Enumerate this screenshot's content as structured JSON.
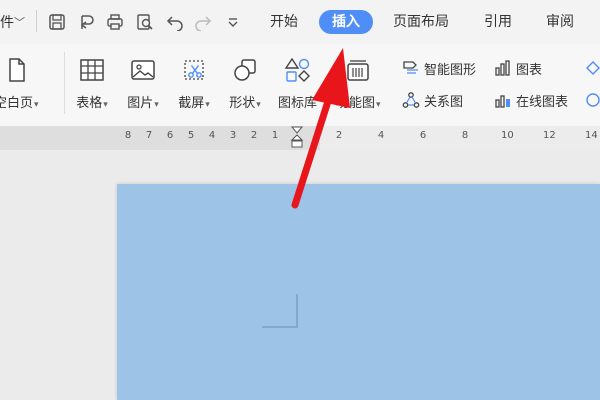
{
  "menubar": {
    "file_label": "件",
    "tabs": [
      {
        "label": "开始"
      },
      {
        "label": "插入"
      },
      {
        "label": "页面布局"
      },
      {
        "label": "引用"
      },
      {
        "label": "审阅"
      }
    ],
    "active_tab": "插入",
    "accent_color": "#4f8ef7"
  },
  "ribbon": {
    "blank_page": "空白页",
    "table": "表格",
    "picture": "图片",
    "screenshot": "截屏",
    "shape": "形状",
    "icon_library": "图标库",
    "function_chart": "功能图",
    "smart_art": "智能图形",
    "chart": "图表",
    "relation_chart": "关系图",
    "online_chart": "在线图表"
  },
  "ruler": {
    "left_ticks": [
      "8",
      "7",
      "6",
      "5",
      "4",
      "3",
      "2",
      "1"
    ],
    "right_ticks": [
      "2",
      "4",
      "6",
      "8",
      "10",
      "12",
      "14"
    ]
  },
  "document": {
    "page_color": "#9dc3e6"
  },
  "annotation": {
    "arrow_color": "#e8161b"
  }
}
